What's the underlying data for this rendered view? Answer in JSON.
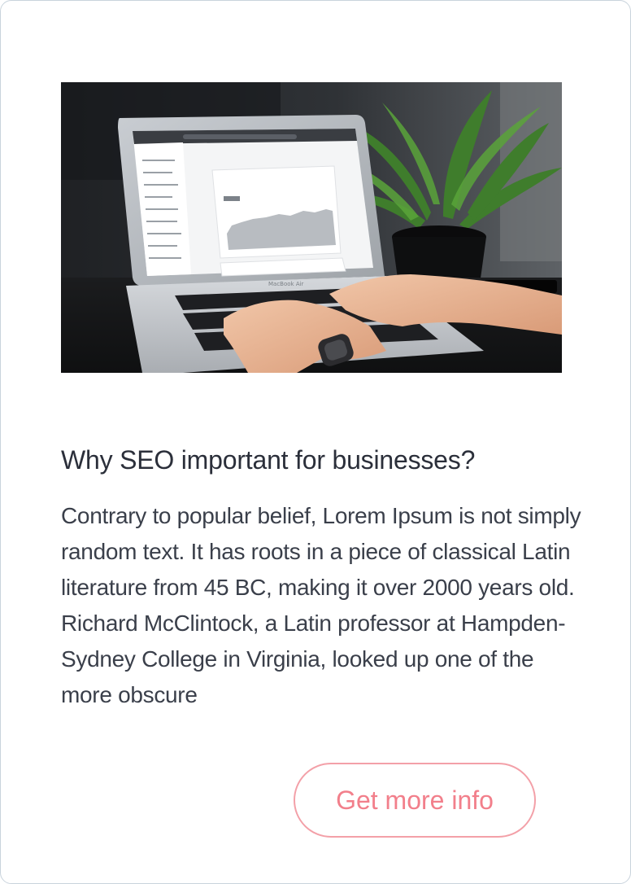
{
  "card": {
    "title": "Why SEO important for businesses?",
    "body": "Contrary to popular belief, Lorem Ipsum is not simply random text. It has roots in a piece of classical Latin literature from 45 BC, making it over 2000 years old. Richard McClintock, a Latin professor at Hampden-Sydney College in Virginia, looked up one of the more obscure",
    "button_label": "Get more info"
  },
  "colors": {
    "card_border": "#c9d3dc",
    "title_text": "#2b2f3a",
    "body_text": "#3a3f4a",
    "button_border": "#f3a0a8",
    "button_text": "#f27f8b"
  }
}
